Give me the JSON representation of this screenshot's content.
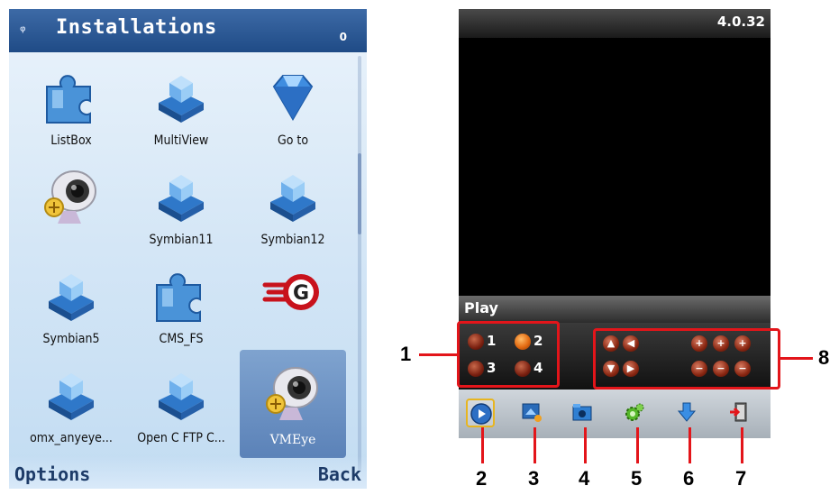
{
  "left_screen": {
    "title": "Installations",
    "status_indicator": "0",
    "apps": [
      {
        "label": "ListBox",
        "icon": "puzzle-icon"
      },
      {
        "label": "MultiView",
        "icon": "symbian-box-icon"
      },
      {
        "label": "Go to",
        "icon": "diamond-icon"
      },
      {
        "label": "",
        "icon": "webcam-icon"
      },
      {
        "label": "Symbian11",
        "icon": "symbian-box-icon"
      },
      {
        "label": "Symbian12",
        "icon": "symbian-box-icon"
      },
      {
        "label": "Symbian5",
        "icon": "symbian-box-icon"
      },
      {
        "label": "CMS_FS",
        "icon": "puzzle-icon"
      },
      {
        "label": "",
        "icon": "g-logo-icon"
      },
      {
        "label": "omx_anyeye...",
        "icon": "symbian-box-icon"
      },
      {
        "label": "Open C FTP C...",
        "icon": "symbian-box-icon"
      },
      {
        "label": "VMEye",
        "icon": "webcam-icon"
      }
    ],
    "selected_index": 11,
    "softkey_left": "Options",
    "softkey_right": "Back"
  },
  "right_screen": {
    "version": "4.0.32",
    "play_label": "Play",
    "channels": [
      "1",
      "2",
      "3",
      "4"
    ],
    "active_channel": "2",
    "toolbar_icons": [
      "play-icon",
      "snapshot-icon",
      "folder-icon",
      "settings-icon",
      "download-icon",
      "exit-icon"
    ]
  },
  "callouts": {
    "n1": "1",
    "n2": "2",
    "n3": "3",
    "n4": "4",
    "n5": "5",
    "n6": "6",
    "n7": "7",
    "n8": "8"
  },
  "colors": {
    "title_bar": "#1f4b86",
    "callout_red": "#e3151a",
    "active_channel": "#e36b12"
  }
}
